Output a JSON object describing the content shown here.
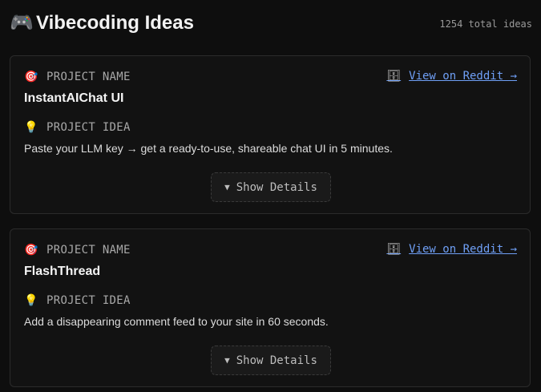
{
  "header": {
    "icon": "game-controller-icon",
    "title": "Vibecoding Ideas",
    "total": "1254 total ideas"
  },
  "cards": [
    {
      "name_label": "PROJECT NAME",
      "name_label_icon": "target-icon",
      "name": "InstantAIChat UI",
      "idea_label": "PROJECT IDEA",
      "idea_label_icon": "lightbulb-icon",
      "idea": "Paste your LLM key → get a ready-to-use, shareable chat UI in 5 minutes.",
      "link_icon": "document-icon",
      "link_label": "View on Reddit →",
      "details_arrow": "▼",
      "details_label": "Show Details"
    },
    {
      "name_label": "PROJECT NAME",
      "name_label_icon": "target-icon",
      "name": "FlashThread",
      "idea_label": "PROJECT IDEA",
      "idea_label_icon": "lightbulb-icon",
      "idea": "Add a disappearing comment feed to your site in 60 seconds.",
      "link_icon": "document-icon",
      "link_label": "View on Reddit →",
      "details_arrow": "▼",
      "details_label": "Show Details"
    }
  ],
  "colors": {
    "background": "#0e0e0e",
    "card_background": "#121212",
    "card_border": "#2b2b2b",
    "link": "#6f9ff5",
    "muted_text": "#a8a8a8"
  }
}
